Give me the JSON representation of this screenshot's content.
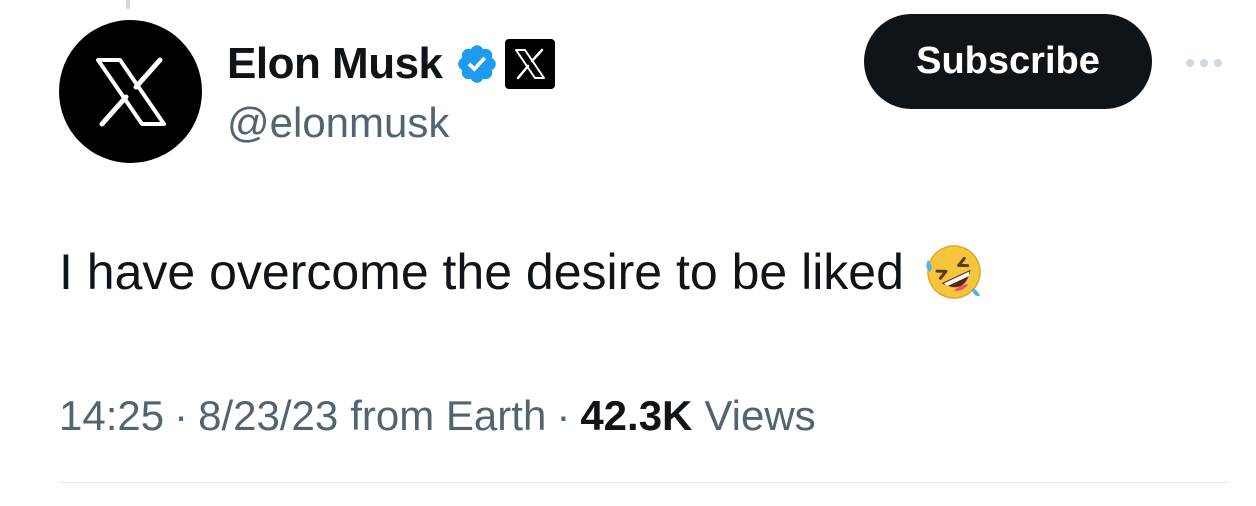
{
  "author": {
    "display_name": "Elon Musk",
    "handle": "@elonmusk",
    "avatar_icon": "x-logo-icon",
    "verified_icon": "verified-badge-icon",
    "affiliate_icon": "x-affiliate-badge-icon",
    "verified_color": "#1d9bf0"
  },
  "actions": {
    "subscribe_label": "Subscribe",
    "more_icon": "more-options-icon"
  },
  "tweet": {
    "text": "I have overcome the desire to be liked",
    "emoji_icon": "rolling-on-floor-laughing-emoji"
  },
  "meta": {
    "time": "14:25",
    "separator": "·",
    "date": "8/23/23",
    "source": "from Earth",
    "views_count": "42.3K",
    "views_label": "Views"
  },
  "colors": {
    "primary_text": "#0f1419",
    "secondary_text": "#536471",
    "button_bg": "#0f1419",
    "divider": "#e7e9ea"
  }
}
